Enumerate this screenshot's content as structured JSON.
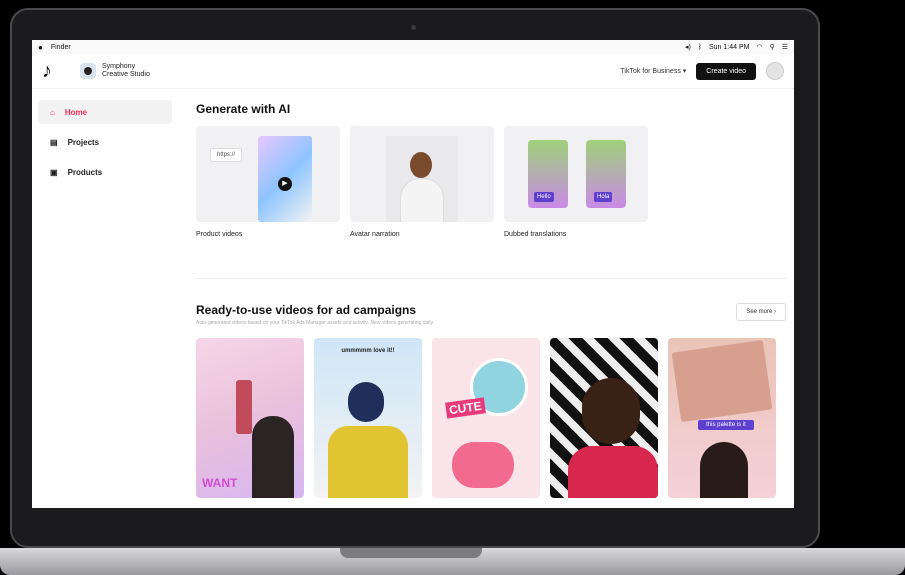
{
  "menubar": {
    "apple": "",
    "app": "Finder",
    "clock": "Sun 1:44 PM"
  },
  "header": {
    "logo": "♪",
    "brand_line1": "Symphony",
    "brand_line2": "Creative Studio",
    "business_link": "TikTok for Business",
    "create_button": "Create video"
  },
  "sidebar": {
    "items": [
      {
        "label": "Home",
        "icon": "home-icon"
      },
      {
        "label": "Projects",
        "icon": "projects-icon"
      },
      {
        "label": "Products",
        "icon": "products-icon"
      }
    ]
  },
  "generate": {
    "title": "Generate with AI",
    "cards": [
      {
        "label": "Product videos",
        "url_text": "https://"
      },
      {
        "label": "Avatar narration"
      },
      {
        "label": "Dubbed translations",
        "tag_left": "Hello",
        "tag_right": "Hola"
      }
    ]
  },
  "campaigns": {
    "title": "Ready-to-use videos for ad campaigns",
    "subtitle": "Auto-generated videos based on your TikTok Ads Manager assets and activity. New videos generating daily.",
    "see_more": "See more",
    "videos": [
      {
        "caption": "",
        "sticker": "WANT"
      },
      {
        "caption": "ummmmm love it!!"
      },
      {
        "caption": "",
        "sticker": "CUTE"
      },
      {
        "caption": ""
      },
      {
        "caption": "this palette is it"
      }
    ]
  },
  "colors": {
    "accent": "#fe2c55",
    "dark": "#111111"
  }
}
